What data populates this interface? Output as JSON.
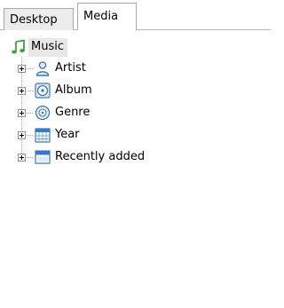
{
  "tabs": {
    "desktop_label": "Desktop",
    "media_label": "Media"
  },
  "tree": {
    "root": {
      "label": "Music",
      "icon": "music-note-icon"
    },
    "items": [
      {
        "label": "Artist",
        "icon": "person-icon"
      },
      {
        "label": "Album",
        "icon": "disc-icon"
      },
      {
        "label": "Genre",
        "icon": "genre-disc-icon"
      },
      {
        "label": "Year",
        "icon": "calendar-icon"
      },
      {
        "label": "Recently added",
        "icon": "window-icon"
      }
    ]
  },
  "colors": {
    "music_green": "#3aa63a",
    "icon_blue": "#3a78c8",
    "selection_bg": "#e8e8e8"
  }
}
